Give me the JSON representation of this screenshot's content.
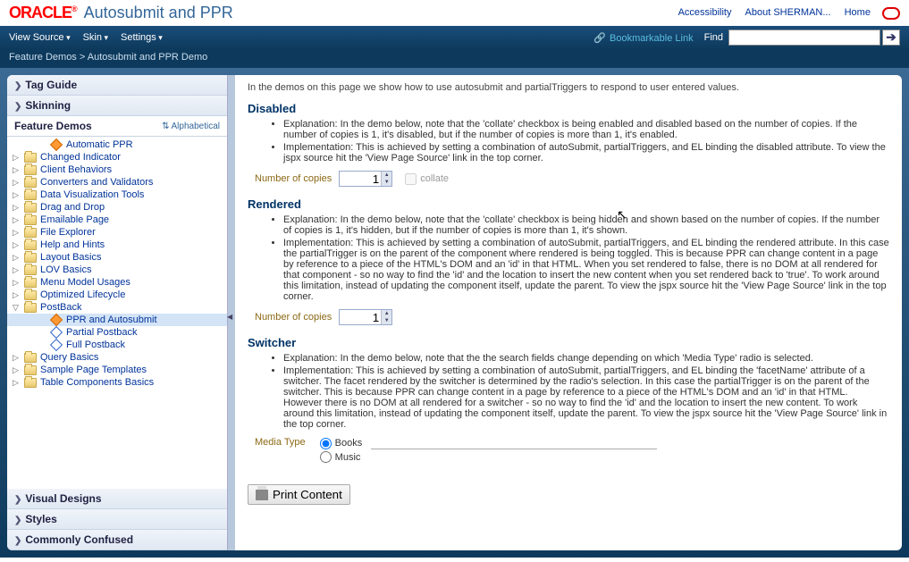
{
  "header": {
    "logo": "ORACLE",
    "app_title": "Autosubmit and PPR",
    "links": {
      "accessibility": "Accessibility",
      "about": "About SHERMAN...",
      "home": "Home"
    }
  },
  "toolbar": {
    "view_source": "View Source",
    "skin": "Skin",
    "settings": "Settings",
    "bookmark": "Bookmarkable Link",
    "find_label": "Find",
    "find_value": ""
  },
  "breadcrumb": {
    "root": "Feature Demos",
    "sep": ">",
    "current": "Autosubmit and PPR Demo"
  },
  "sidebar": {
    "sections": {
      "tag_guide": "Tag Guide",
      "skinning": "Skinning",
      "feature_demos": "Feature Demos",
      "alphabetical": "Alphabetical",
      "visual_designs": "Visual Designs",
      "styles": "Styles",
      "commonly_confused": "Commonly Confused"
    },
    "tree": [
      {
        "label": "Automatic PPR",
        "type": "leaf-doc"
      },
      {
        "label": "Changed Indicator",
        "type": "folder"
      },
      {
        "label": "Client Behaviors",
        "type": "folder"
      },
      {
        "label": "Converters and Validators",
        "type": "folder"
      },
      {
        "label": "Data Visualization Tools",
        "type": "folder"
      },
      {
        "label": "Drag and Drop",
        "type": "folder"
      },
      {
        "label": "Emailable Page",
        "type": "folder"
      },
      {
        "label": "File Explorer",
        "type": "folder"
      },
      {
        "label": "Help and Hints",
        "type": "folder"
      },
      {
        "label": "Layout Basics",
        "type": "folder"
      },
      {
        "label": "LOV Basics",
        "type": "folder"
      },
      {
        "label": "Menu Model Usages",
        "type": "folder"
      },
      {
        "label": "Optimized Lifecycle",
        "type": "folder"
      },
      {
        "label": "PostBack",
        "type": "folder-open",
        "children": [
          {
            "label": "PPR and Autosubmit",
            "selected": true
          },
          {
            "label": "Partial Postback"
          },
          {
            "label": "Full Postback"
          }
        ]
      },
      {
        "label": "Query Basics",
        "type": "folder"
      },
      {
        "label": "Sample Page Templates",
        "type": "folder"
      },
      {
        "label": "Table Components Basics",
        "type": "folder"
      }
    ]
  },
  "content": {
    "intro": "In the demos on this page we show how to use autosubmit and partialTriggers to respond to user entered values.",
    "disabled": {
      "title": "Disabled",
      "b1": "Explanation: In the demo below, note that the 'collate' checkbox is being enabled and disabled based on the number of copies. If the number of copies is 1, it's disabled, but if the number of copies is more than 1, it's enabled.",
      "b2": "Implementation: This is achieved by setting a combination of autoSubmit, partialTriggers, and EL binding the disabled attribute. To view the jspx source hit the 'View Page Source' link in the top corner.",
      "copies_label": "Number of copies",
      "copies_value": "1",
      "collate_label": "collate"
    },
    "rendered": {
      "title": "Rendered",
      "b1": "Explanation: In the demo below, note that the 'collate' checkbox is being hidden and shown based on the number of copies. If the number of copies is 1, it's hidden, but if the number of copies is more than 1, it's shown.",
      "b2": "Implementation: This is achieved by setting a combination of autoSubmit, partialTriggers, and EL binding the rendered attribute. In this case the partialTrigger is on the parent of the component where rendered is being toggled. This is because PPR can change content in a page by reference to a piece of the HTML's DOM and an 'id' in that HTML. When you set rendered to false, there is no DOM at all rendered for that component - so no way to find the 'id' and the location to insert the new content when you set rendered back to 'true'. To work around this limitation, instead of updating the component itself, update the parent. To view the jspx source hit the 'View Page Source' link in the top corner.",
      "copies_label": "Number of copies",
      "copies_value": "1"
    },
    "switcher": {
      "title": "Switcher",
      "b1": "Explanation: In the demo below, note that the the search fields change depending on which 'Media Type' radio is selected.",
      "b2": "Implementation: This is achieved by setting a combination of autoSubmit, partialTriggers, and EL binding the 'facetName' attribute of a switcher. The facet rendered by the switcher is determined by the radio's selection. In this case the partialTrigger is on the parent of the switcher. This is because PPR can change content in a page by reference to a piece of the HTML's DOM and an 'id' in that HTML. However there is no DOM at all rendered for a switcher - so no way to find the 'id' and the location to insert the new content. To work around this limitation, instead of updating the component itself, update the parent. To view the jspx source hit the 'View Page Source' link in the top corner.",
      "media_label": "Media Type",
      "opt1": "Books",
      "opt2": "Music"
    },
    "print_btn": "Print Content"
  }
}
